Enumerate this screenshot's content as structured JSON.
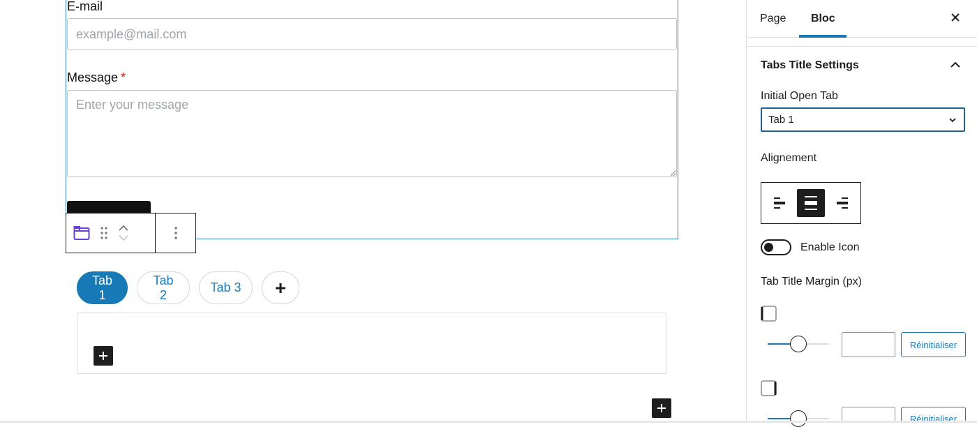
{
  "editor": {
    "form": {
      "email_label": "E-mail",
      "email_placeholder": "example@mail.com",
      "message_label": "Message",
      "message_required_mark": "*",
      "message_placeholder": "Enter your message"
    },
    "block_toolbar": {
      "icons": [
        "tabs-block-icon",
        "drag-handle-icon",
        "move-up-icon",
        "move-down-icon",
        "more-options-icon"
      ]
    },
    "tabs": [
      {
        "label": "Tab 1",
        "active": true
      },
      {
        "label": "Tab 2",
        "active": false
      },
      {
        "label": "Tab 3",
        "active": false
      }
    ],
    "add_tab_icon": "plus-icon",
    "accent_color": "#1779b6"
  },
  "sidebar": {
    "tabs": [
      {
        "label": "Page",
        "active": false
      },
      {
        "label": "Bloc",
        "active": true
      }
    ],
    "close_icon": "close-icon",
    "section_title": "Tabs Title Settings",
    "initial_open_tab": {
      "label": "Initial Open Tab",
      "selected": "Tab 1"
    },
    "alignment": {
      "label": "Alignement",
      "options": [
        "left",
        "center",
        "right"
      ],
      "selected": "center"
    },
    "enable_icon": {
      "label": "Enable Icon",
      "checked": false
    },
    "margin": {
      "label": "Tab Title Margin (px)",
      "rows": [
        {
          "side": "left",
          "slider_percent": 50,
          "value": "",
          "reset_label": "Réinitialiser"
        },
        {
          "side": "right",
          "slider_percent": 50,
          "value": "",
          "reset_label": "Réinitialiser"
        }
      ]
    }
  }
}
